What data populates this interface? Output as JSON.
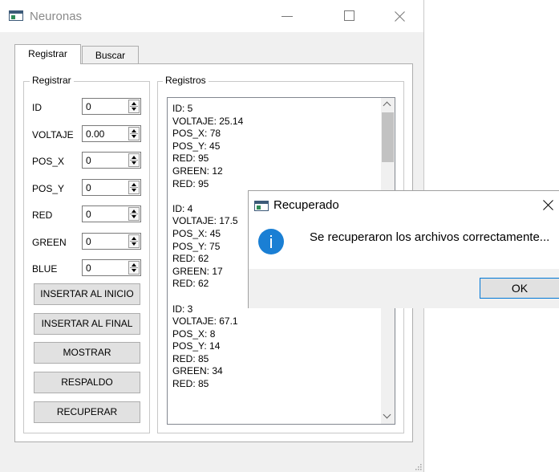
{
  "window": {
    "title": "Neuronas"
  },
  "tabs": [
    {
      "label": "Registrar"
    },
    {
      "label": "Buscar"
    }
  ],
  "registrar": {
    "group_title": "Registrar",
    "fields": [
      {
        "label": "ID",
        "value": "0"
      },
      {
        "label": "VOLTAJE",
        "value": "0.00"
      },
      {
        "label": "POS_X",
        "value": "0"
      },
      {
        "label": "POS_Y",
        "value": "0"
      },
      {
        "label": "RED",
        "value": "0"
      },
      {
        "label": "GREEN",
        "value": "0"
      },
      {
        "label": "BLUE",
        "value": "0"
      }
    ],
    "buttons": [
      {
        "label": "INSERTAR AL INICIO"
      },
      {
        "label": "INSERTAR AL FINAL"
      },
      {
        "label": "MOSTRAR"
      },
      {
        "label": "RESPALDO"
      },
      {
        "label": "RECUPERAR"
      }
    ]
  },
  "registros": {
    "group_title": "Registros",
    "text": "ID: 5\nVOLTAJE: 25.14\nPOS_X: 78\nPOS_Y: 45\nRED: 95\nGREEN: 12\nRED: 95\n\nID: 4\nVOLTAJE: 17.5\nPOS_X: 45\nPOS_Y: 75\nRED: 62\nGREEN: 17\nRED: 62\n\nID: 3\nVOLTAJE: 67.1\nPOS_X: 8\nPOS_Y: 14\nRED: 85\nGREEN: 34\nRED: 85"
  },
  "dialog": {
    "title": "Recuperado",
    "message": "Se recuperaron los archivos correctamente...",
    "ok_label": "OK"
  }
}
